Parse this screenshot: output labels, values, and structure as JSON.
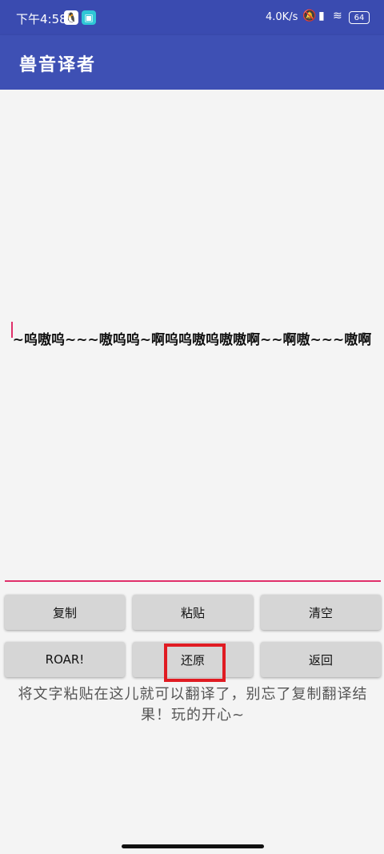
{
  "status_bar": {
    "time": "下午4:58",
    "qq_icon": "qq-penguin-icon",
    "app_icon": "app-notification-icon",
    "network_speed": "4.0K/s",
    "battery": "64",
    "icons": [
      "mute-bell-icon",
      "signal-icon",
      "wifi-icon",
      "battery-icon"
    ]
  },
  "app_bar": {
    "title": "兽音译者"
  },
  "editor": {
    "text": "~呜嗷呜~~~嗷呜呜~啊呜呜嗷呜嗷嗷啊~~啊嗷~~~嗷啊",
    "accent_color": "#e0306a"
  },
  "buttons": {
    "copy": "复制",
    "paste": "粘贴",
    "clear": "清空",
    "roar": "ROAR!",
    "restore": "还原",
    "back": "返回"
  },
  "hint": "将文字粘贴在这儿就可以翻译了，别忘了复制翻译结果！玩的开心~",
  "colors": {
    "primary": "#3e50b4",
    "status": "#3a4bb0",
    "highlight": "#e01b22"
  }
}
